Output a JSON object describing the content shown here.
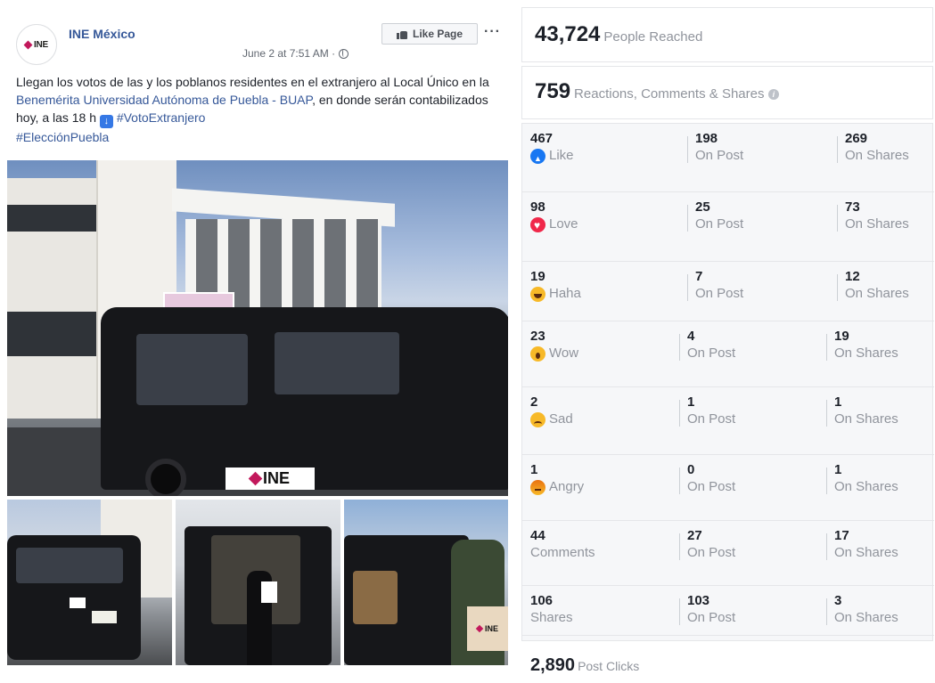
{
  "post": {
    "page_name": "INE México",
    "logo_text": "INE",
    "timestamp": "June 2 at 7:51 AM ·",
    "like_page_label": "Like Page",
    "more_label": "···",
    "text_part1": "Llegan los votos de las y los poblanos residentes en el extranjero al Local Único en la ",
    "link_university": "Benemérita Universidad Autónoma de Puebla - BUAP",
    "text_part2": ", en donde serán contabilizados hoy, a las 18 h ",
    "hashtag_1": "#VotoExtranjero",
    "hashtag_2": "#ElecciónPuebla",
    "van_sticker": "INE"
  },
  "insights": {
    "reach": {
      "value": "43,724",
      "label": "People Reached"
    },
    "engagement": {
      "value": "759",
      "label": "Reactions, Comments & Shares"
    },
    "rows": [
      {
        "total": "467",
        "label": "Like",
        "icon": "like-reaction-icon",
        "on_post": "198",
        "on_post_label": "On Post",
        "on_shares": "269",
        "on_shares_label": "On Shares"
      },
      {
        "total": "98",
        "label": "Love",
        "icon": "love-reaction-icon",
        "on_post": "25",
        "on_post_label": "On Post",
        "on_shares": "73",
        "on_shares_label": "On Shares"
      },
      {
        "total": "19",
        "label": "Haha",
        "icon": "haha-reaction-icon",
        "on_post": "7",
        "on_post_label": "On Post",
        "on_shares": "12",
        "on_shares_label": "On Shares"
      },
      {
        "total": "23",
        "label": "Wow",
        "icon": "wow-reaction-icon",
        "on_post": "4",
        "on_post_label": "On Post",
        "on_shares": "19",
        "on_shares_label": "On Shares"
      },
      {
        "total": "2",
        "label": "Sad",
        "icon": "sad-reaction-icon",
        "on_post": "1",
        "on_post_label": "On Post",
        "on_shares": "1",
        "on_shares_label": "On Shares"
      },
      {
        "total": "1",
        "label": "Angry",
        "icon": "angry-reaction-icon",
        "on_post": "0",
        "on_post_label": "On Post",
        "on_shares": "1",
        "on_shares_label": "On Shares"
      },
      {
        "total": "44",
        "label": "Comments",
        "icon": "",
        "on_post": "27",
        "on_post_label": "On Post",
        "on_shares": "17",
        "on_shares_label": "On Shares"
      },
      {
        "total": "106",
        "label": "Shares",
        "icon": "",
        "on_post": "103",
        "on_post_label": "On Post",
        "on_shares": "3",
        "on_shares_label": "On Shares"
      }
    ],
    "clicks": {
      "value": "2,890",
      "label": "Post Clicks"
    }
  },
  "colors": {
    "link": "#365899",
    "like_blue": "#1877f2",
    "love_red": "#f0284a",
    "emoji_yellow": "#f7b928",
    "muted_text": "#90949c",
    "ine_magenta": "#c2185b"
  }
}
